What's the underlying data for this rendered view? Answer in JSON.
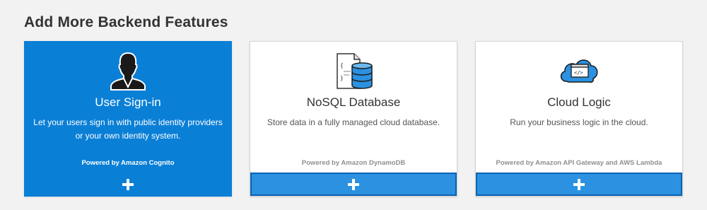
{
  "section": {
    "title": "Add More Backend Features"
  },
  "cards": [
    {
      "title": "User Sign-in",
      "description": "Let your users sign in with public identity providers or your own identity system.",
      "powered_by": "Powered by Amazon Cognito",
      "icon": "user-silhouette-icon",
      "selected": true
    },
    {
      "title": "NoSQL Database",
      "description": "Store data in a fully managed cloud database.",
      "powered_by": "Powered by Amazon DynamoDB",
      "icon": "database-icon",
      "selected": false
    },
    {
      "title": "Cloud Logic",
      "description": "Run your business logic in the cloud.",
      "powered_by": "Powered by Amazon API Gateway and AWS Lambda",
      "icon": "cloud-code-icon",
      "selected": false
    }
  ],
  "colors": {
    "selected_card": "#0a7fd6",
    "add_bar": "#2b91e0",
    "add_bar_border": "#0b63b0"
  }
}
